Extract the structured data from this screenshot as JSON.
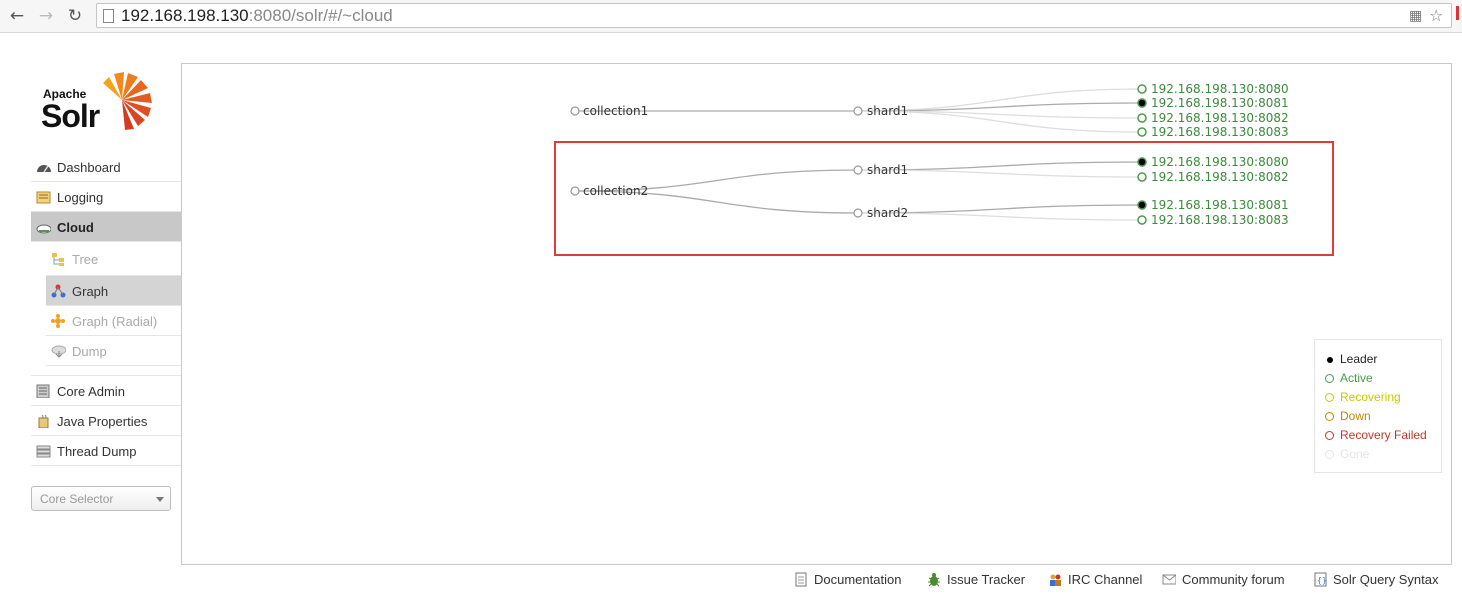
{
  "browser": {
    "url_host": "192.168.198.130",
    "url_rest": ":8080/solr/#/~cloud"
  },
  "logo": {
    "apache": "Apache",
    "solr": "Solr"
  },
  "menu": {
    "dashboard": "Dashboard",
    "logging": "Logging",
    "cloud": "Cloud",
    "tree": "Tree",
    "graph": "Graph",
    "graph_radial": "Graph (Radial)",
    "dump": "Dump",
    "core_admin": "Core Admin",
    "java_properties": "Java Properties",
    "thread_dump": "Thread Dump"
  },
  "core_selector": {
    "placeholder": "Core Selector"
  },
  "graph": {
    "collections": [
      {
        "name": "collection1",
        "shards": [
          {
            "name": "shard1",
            "replicas": [
              {
                "host": "192.168.198.130:8080",
                "state": "Active"
              },
              {
                "host": "192.168.198.130:8081",
                "state": "Leader"
              },
              {
                "host": "192.168.198.130:8082",
                "state": "Active"
              },
              {
                "host": "192.168.198.130:8083",
                "state": "Active"
              }
            ]
          }
        ]
      },
      {
        "name": "collection2",
        "shards": [
          {
            "name": "shard1",
            "replicas": [
              {
                "host": "192.168.198.130:8080",
                "state": "Leader"
              },
              {
                "host": "192.168.198.130:8082",
                "state": "Active"
              }
            ]
          },
          {
            "name": "shard2",
            "replicas": [
              {
                "host": "192.168.198.130:8081",
                "state": "Leader"
              },
              {
                "host": "192.168.198.130:8083",
                "state": "Active"
              }
            ]
          }
        ]
      }
    ],
    "highlight_color": "#e03c3c"
  },
  "legend": {
    "leader": "Leader",
    "active": "Active",
    "recovering": "Recovering",
    "down": "Down",
    "recovery_failed": "Recovery Failed",
    "gone": "Gone",
    "colors": {
      "leader": "#000000",
      "active": "#4b9b4b",
      "recovering": "#c8c800",
      "down": "#c08a00",
      "recovery_failed": "#c0392b",
      "gone": "#e6e6e6"
    }
  },
  "footer": {
    "documentation": "Documentation",
    "issue_tracker": "Issue Tracker",
    "irc_channel": "IRC Channel",
    "community_forum": "Community forum",
    "solr_query_syntax": "Solr Query Syntax"
  }
}
